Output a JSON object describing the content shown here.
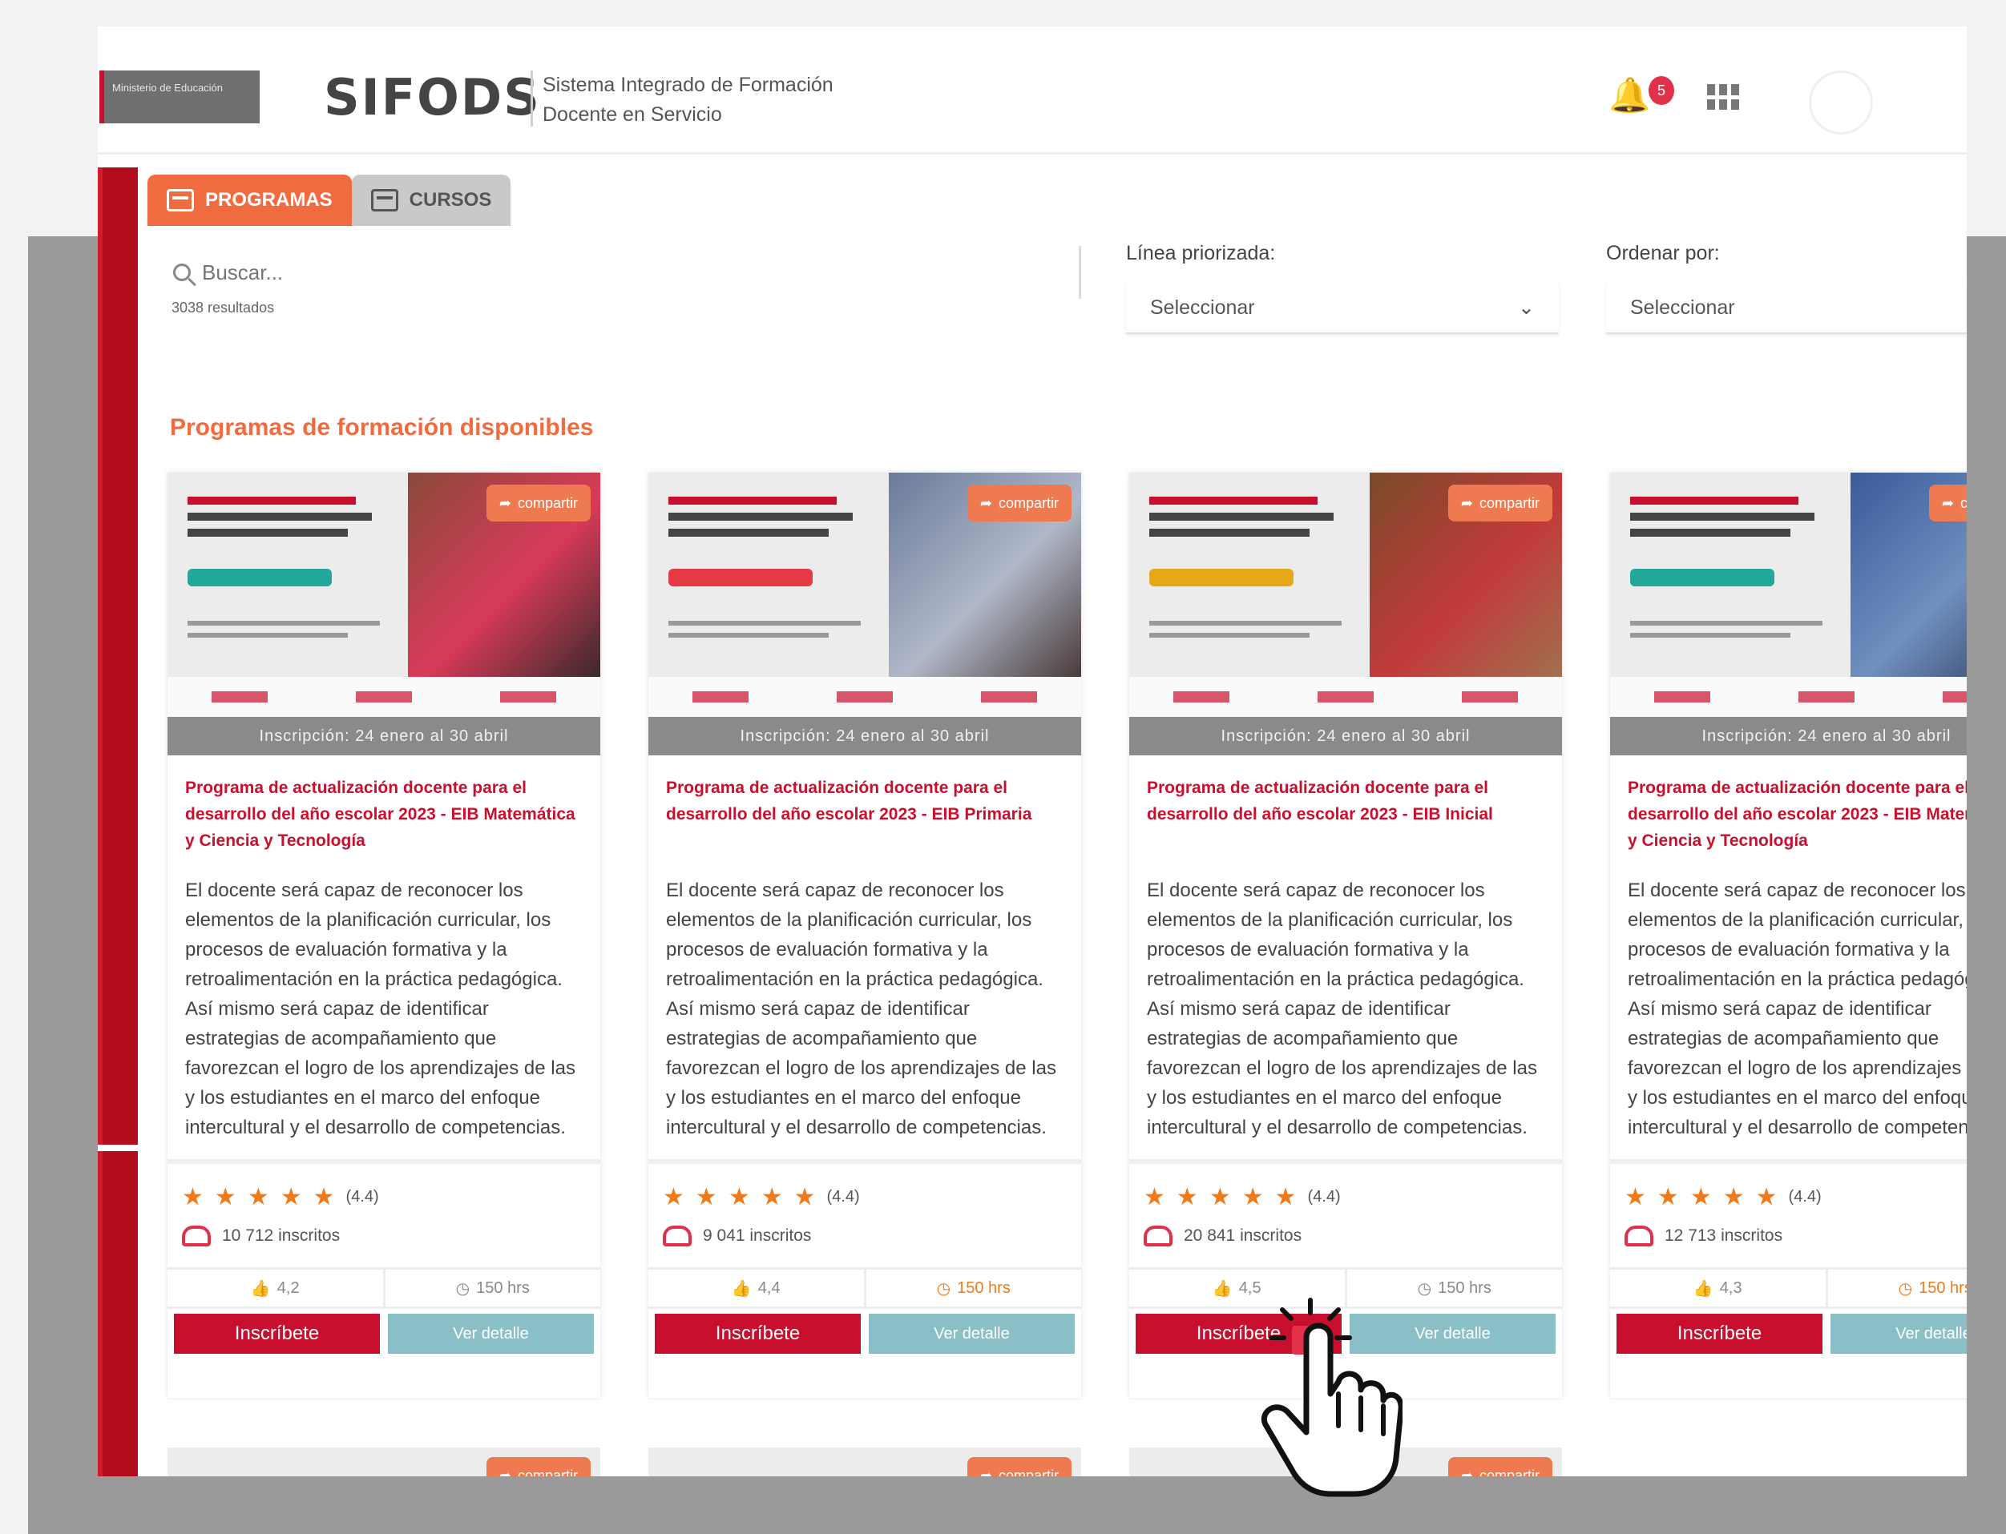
{
  "header": {
    "gov_logo_text": "Ministerio de Educación",
    "brand": "SIFODS",
    "subtitle_line1": "Sistema Integrado de Formación",
    "subtitle_line2": "Docente en Servicio",
    "notification_count": "5"
  },
  "tabs": [
    {
      "label": "PROGRAMAS",
      "active": true
    },
    {
      "label": "CURSOS",
      "active": false
    }
  ],
  "search": {
    "placeholder": "Buscar...",
    "results": "3038 resultados"
  },
  "filters": {
    "line_label": "Línea priorizada:",
    "line_value": "Seleccionar",
    "order_label": "Ordenar por:",
    "order_value": "Seleccionar"
  },
  "section_title": "Programas de formación disponibles",
  "cards": [
    {
      "share": "compartir",
      "bar": "Inscripción: 24 enero al 30 abril",
      "title": "Programa de actualización docente para el desarrollo del año escolar 2023 - EIB Matemática y Ciencia y Tecnología",
      "description": "El docente será capaz de reconocer los elementos de la planificación curricular, los procesos de evaluación formativa y la retroalimentación en la práctica pedagógica. Así mismo será capaz de identificar estrategias de acompañamiento que favorezcan el logro de los aprendizajes de las y los estudiantes en el marco del enfoque intercultural y el desarrollo de competencias.",
      "rating": "(4.4)",
      "enrolled": "10 712 inscritos",
      "stat1": "4,2",
      "stat2": "150 hrs",
      "inscribe": "Inscríbete",
      "detail": "Ver detalle",
      "pill": "teal"
    },
    {
      "share": "compartir",
      "bar": "Inscripción: 24 enero al 30 abril",
      "title": "Programa de actualización docente para el desarrollo del año escolar 2023 - EIB Primaria",
      "description": "El docente será capaz de reconocer los elementos de la planificación curricular, los procesos de evaluación formativa y la retroalimentación en la práctica pedagógica. Así mismo será capaz de identificar estrategias de acompañamiento que favorezcan el logro de los aprendizajes de las y los estudiantes en el marco del enfoque intercultural y el desarrollo de competencias.",
      "rating": "(4.4)",
      "enrolled": "9 041 inscritos",
      "stat1": "4,4",
      "stat2": "150 hrs",
      "inscribe": "Inscríbete",
      "detail": "Ver detalle",
      "pill": "red"
    },
    {
      "share": "compartir",
      "bar": "Inscripción: 24 enero al 30 abril",
      "title": "Programa de actualización docente para el desarrollo del año escolar 2023 - EIB Inicial",
      "description": "El docente será capaz de reconocer los elementos de la planificación curricular, los procesos de evaluación formativa y la retroalimentación en la práctica pedagógica. Así mismo será capaz de identificar estrategias de acompañamiento que favorezcan el logro de los aprendizajes de las y los estudiantes en el marco del enfoque intercultural y el desarrollo de competencias.",
      "rating": "(4.4)",
      "enrolled": "20 841 inscritos",
      "stat1": "4,5",
      "stat2": "150 hrs",
      "inscribe": "Inscríbete",
      "detail": "Ver detalle",
      "pill": "yellow"
    },
    {
      "share": "compartir",
      "bar": "Inscripción: 24 enero al 30 abril",
      "title": "Programa de actualización docente para el desarrollo del año escolar 2023 - EIB Matemática y Ciencia y Tecnología",
      "description": "El docente será capaz de reconocer los elementos de la planificación curricular, los procesos de evaluación formativa y la retroalimentación en la práctica pedagógica. Así mismo será capaz de identificar estrategias de acompañamiento que favorezcan el logro de los aprendizajes de las y los estudiantes en el marco del enfoque intercultural y el desarrollo de competencias.",
      "rating": "(4.4)",
      "enrolled": "12 713 inscritos",
      "stat1": "4,3",
      "stat2": "150 hrs",
      "inscribe": "Inscríbete",
      "detail": "Ver detalle",
      "pill": "teal"
    }
  ],
  "second_row_share": "compartir"
}
